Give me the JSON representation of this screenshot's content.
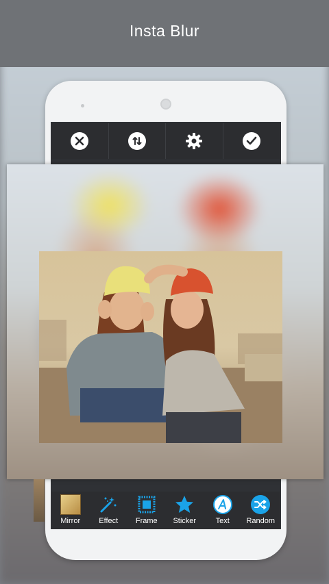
{
  "app": {
    "title": "Insta Blur"
  },
  "toolbar": {
    "buttons": [
      {
        "name": "close",
        "icon": "close-icon"
      },
      {
        "name": "swap",
        "icon": "swap-vertical-icon"
      },
      {
        "name": "settings",
        "icon": "gear-icon"
      },
      {
        "name": "confirm",
        "icon": "check-icon"
      }
    ]
  },
  "menu": {
    "items": [
      {
        "label": "Mirror",
        "icon": "mirror-thumbnail-icon"
      },
      {
        "label": "Effect",
        "icon": "magic-wand-icon"
      },
      {
        "label": "Frame",
        "icon": "frame-icon"
      },
      {
        "label": "Sticker",
        "icon": "star-icon"
      },
      {
        "label": "Text",
        "icon": "text-a-icon"
      },
      {
        "label": "Random",
        "icon": "shuffle-icon"
      }
    ]
  },
  "colors": {
    "accent": "#1aa3e8",
    "toolbar_bg": "#2c2d30",
    "topbar_bg": "#6f7276"
  }
}
